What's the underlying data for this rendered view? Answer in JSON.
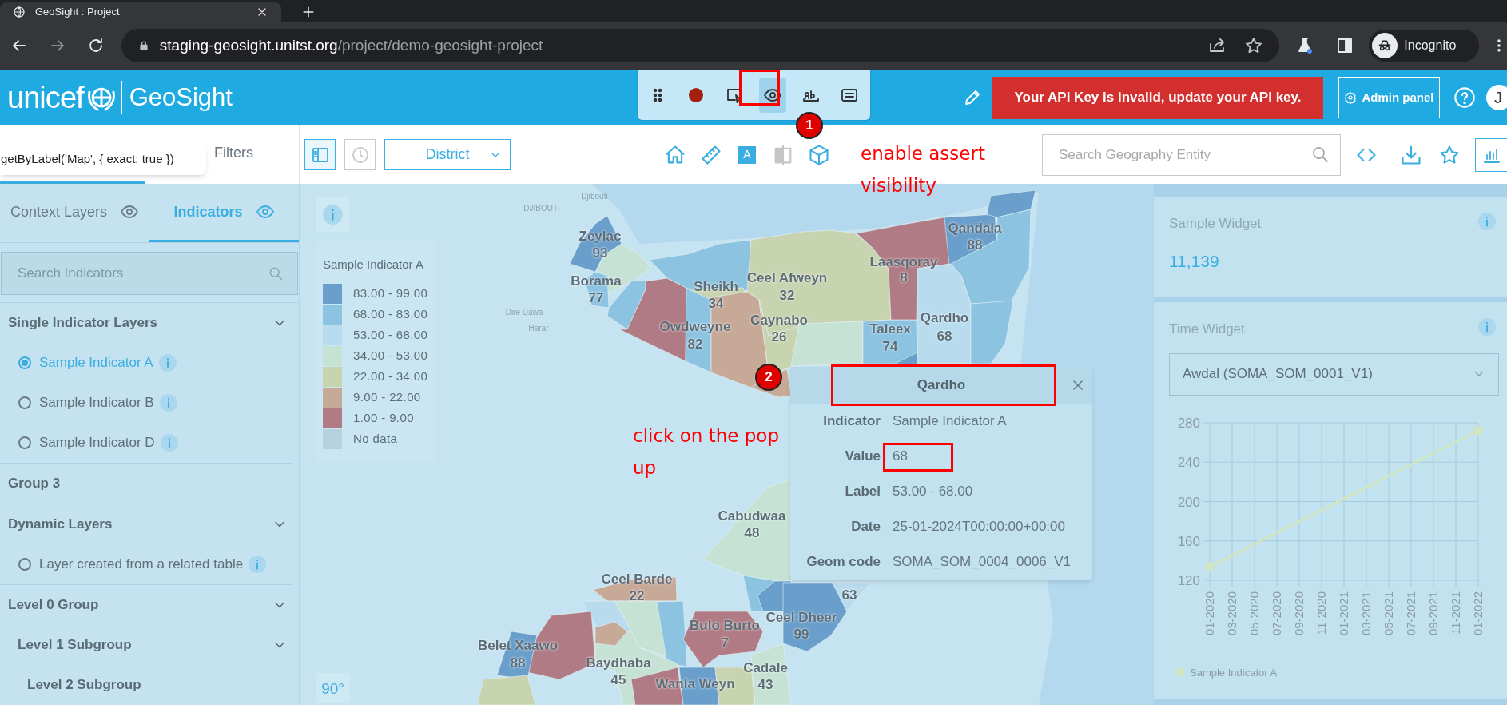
{
  "browser": {
    "tab_title": "GeoSight : Project",
    "url_host": "staging-geosight.unitst.org",
    "url_path": "/project/demo-geosight-project",
    "profile_label": "Incognito"
  },
  "header": {
    "logo_text": "unicef",
    "app_name": "GeoSight",
    "api_key_warning": "Your API Key is invalid, update your API key.",
    "admin_button": "Admin panel",
    "avatar_initial": "J"
  },
  "recorder_toolbar": [
    {
      "kind": "drag",
      "selected": false
    },
    {
      "kind": "record",
      "selected": false
    },
    {
      "kind": "pick",
      "selected": false
    },
    {
      "kind": "visibility",
      "selected": true
    },
    {
      "kind": "text",
      "selected": false
    },
    {
      "kind": "value",
      "selected": false
    }
  ],
  "locator_tooltip": "getByLabel('Map', { exact: true })",
  "left_panel": {
    "top_tabs": [
      {
        "selected": true
      },
      {
        "label": "Filters",
        "selected": false
      }
    ],
    "layer_tabs": [
      {
        "label": "Context Layers",
        "selected": false
      },
      {
        "label": "Indicators",
        "selected": true
      }
    ],
    "search_placeholder": "Search Indicators",
    "groups": [
      {
        "title": "Single Indicator Layers",
        "expanded": true,
        "layers": [
          {
            "label": "Sample Indicator A",
            "selected": true
          },
          {
            "label": "Sample Indicator B",
            "selected": false
          },
          {
            "label": "Sample Indicator D",
            "selected": false
          }
        ]
      },
      {
        "title": "Group 3"
      },
      {
        "title": "Dynamic Layers",
        "expanded": true,
        "layers": [
          {
            "label": "Layer created from a related table",
            "selected": false
          }
        ]
      },
      {
        "title": "Level 0 Group",
        "expanded": true,
        "children": [
          {
            "title": "Level 1 Subgroup",
            "expanded": true,
            "children": [
              {
                "title": "Level 2 Subgroup"
              }
            ]
          }
        ]
      }
    ]
  },
  "map_toolbar": {
    "buttons": [
      {
        "kind": "panel",
        "selected": true
      },
      {
        "kind": "history",
        "selected": false
      }
    ],
    "level": "District",
    "tools": [
      {
        "kind": "home",
        "disabled": false
      },
      {
        "kind": "ruler",
        "disabled": false
      },
      {
        "kind": "label",
        "glyph": "A",
        "disabled": false
      },
      {
        "kind": "compare",
        "disabled": true
      },
      {
        "kind": "cube",
        "disabled": false
      }
    ],
    "search_placeholder": "Search Geography Entity",
    "actions": [
      {
        "kind": "embed"
      },
      {
        "kind": "download"
      },
      {
        "kind": "bookmark"
      },
      {
        "kind": "widgets"
      }
    ]
  },
  "map": {
    "basemap_labels": [
      "DJIBOUTI",
      "Djibouti",
      "Dire Dawa",
      "Harar"
    ],
    "legend": {
      "title": "Sample Indicator A",
      "items": [
        {
          "label": "83.00 - 99.00",
          "color": "#6a9fcc"
        },
        {
          "label": "68.00 - 83.00",
          "color": "#8cc3e1"
        },
        {
          "label": "53.00 - 68.00",
          "color": "#b8dcee"
        },
        {
          "label": "34.00 - 53.00",
          "color": "#c6e2d4"
        },
        {
          "label": "22.00 - 34.00",
          "color": "#c8d3b0"
        },
        {
          "label": "9.00 - 22.00",
          "color": "#c7a998"
        },
        {
          "label": "1.00 - 9.00",
          "color": "#b07b84"
        },
        {
          "label": "No data",
          "color": "#b7d2df"
        }
      ]
    },
    "region_labels": [
      {
        "name": "Zeylac",
        "value": "93"
      },
      {
        "name": "Borama",
        "value": "77"
      },
      {
        "name": "Sheikh",
        "value": "34"
      },
      {
        "name": "Owdweyne",
        "value": "82"
      },
      {
        "name": "Ceel Afweyn",
        "value": "32"
      },
      {
        "name": "Caynabo",
        "value": "26"
      },
      {
        "name": "Laasqoray",
        "value": "8"
      },
      {
        "name": "Qandala",
        "value": "88"
      },
      {
        "name": "Qardho",
        "value": "68"
      },
      {
        "name": "Taleex",
        "value": "74"
      },
      {
        "name": "Cabudwaa",
        "value": "48"
      },
      {
        "name": "Ceel Barde",
        "value": "22"
      },
      {
        "name": "Bulo Burto",
        "value": "7"
      },
      {
        "name": "Ceel Dheer",
        "value": "99"
      },
      {
        "value": "63"
      },
      {
        "name": "Belet Xaawo",
        "value": "88"
      },
      {
        "name": "Baydhaba",
        "value": "45"
      },
      {
        "name": "Wanla Weyn"
      },
      {
        "name": "Cadale",
        "value": "43"
      }
    ],
    "bearing": "90°"
  },
  "popup": {
    "title": "Qardho",
    "rows": [
      {
        "label": "Indicator",
        "value": "Sample Indicator A"
      },
      {
        "label": "Value",
        "value": "68"
      },
      {
        "label": "Label",
        "value": "53.00 - 68.00"
      },
      {
        "label": "Date",
        "value": "25-01-2024T00:00:00+00:00"
      },
      {
        "label": "Geom code",
        "value": "SOMA_SOM_0004_0006_V1"
      }
    ]
  },
  "widgets": [
    {
      "kind": "summary",
      "title": "Sample Widget",
      "value": "11,139"
    },
    {
      "kind": "time_series",
      "title": "Time Widget",
      "select": "Awdal (SOMA_SOM_0001_V1)",
      "chart_data": {
        "type": "line",
        "categories": [
          "01-2020",
          "03-2020",
          "05-2020",
          "07-2020",
          "09-2020",
          "11-2020",
          "01-2021",
          "03-2021",
          "05-2021",
          "07-2021",
          "09-2021",
          "11-2021",
          "01-2022"
        ],
        "grid": true,
        "series": [
          {
            "name": "Sample Indicator A",
            "color": "#cfe6c4",
            "marker": true,
            "values": [
              134,
              null,
              null,
              null,
              null,
              null,
              null,
              null,
              null,
              null,
              null,
              null,
              272
            ]
          }
        ],
        "ylim": [
          120,
          280
        ],
        "yticks": [
          120,
          160,
          200,
          240,
          280
        ]
      }
    }
  ],
  "annotations": [
    {
      "kind": "frame"
    },
    {
      "kind": "step",
      "label": "1"
    },
    {
      "kind": "note",
      "text": "enable assert visibility"
    },
    {
      "kind": "step",
      "label": "2"
    },
    {
      "kind": "frame"
    },
    {
      "kind": "note",
      "text": "click on the pop up"
    },
    {
      "kind": "frame"
    }
  ]
}
